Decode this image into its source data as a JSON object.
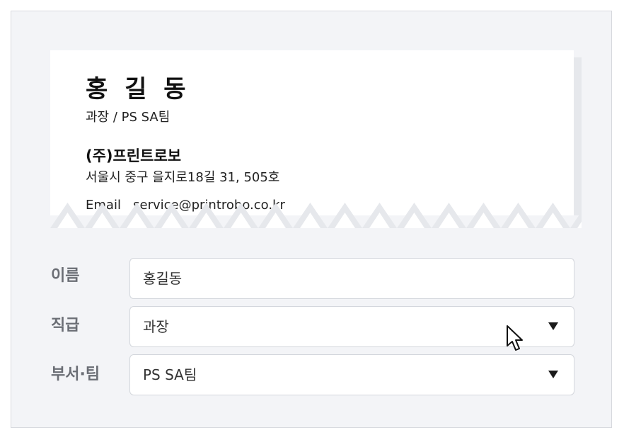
{
  "card": {
    "name": "홍 길 동",
    "title": "과장 / PS SA팀",
    "company": "(주)프린트로보",
    "address": "서울시 중구 을지로18길 31, 505호",
    "email_label": "Email",
    "email": "service@printrobo.co.kr"
  },
  "form": {
    "name_label": "이름",
    "name_value": "홍길동",
    "rank_label": "직급",
    "rank_value": "과장",
    "dept_label": "부서·팀",
    "dept_value": "PS SA팀"
  },
  "colors": {
    "panel_bg": "#f3f4f7",
    "label": "#6b6e75",
    "field_border": "#d3d6dc",
    "zigzag": "#e6e8ec"
  }
}
